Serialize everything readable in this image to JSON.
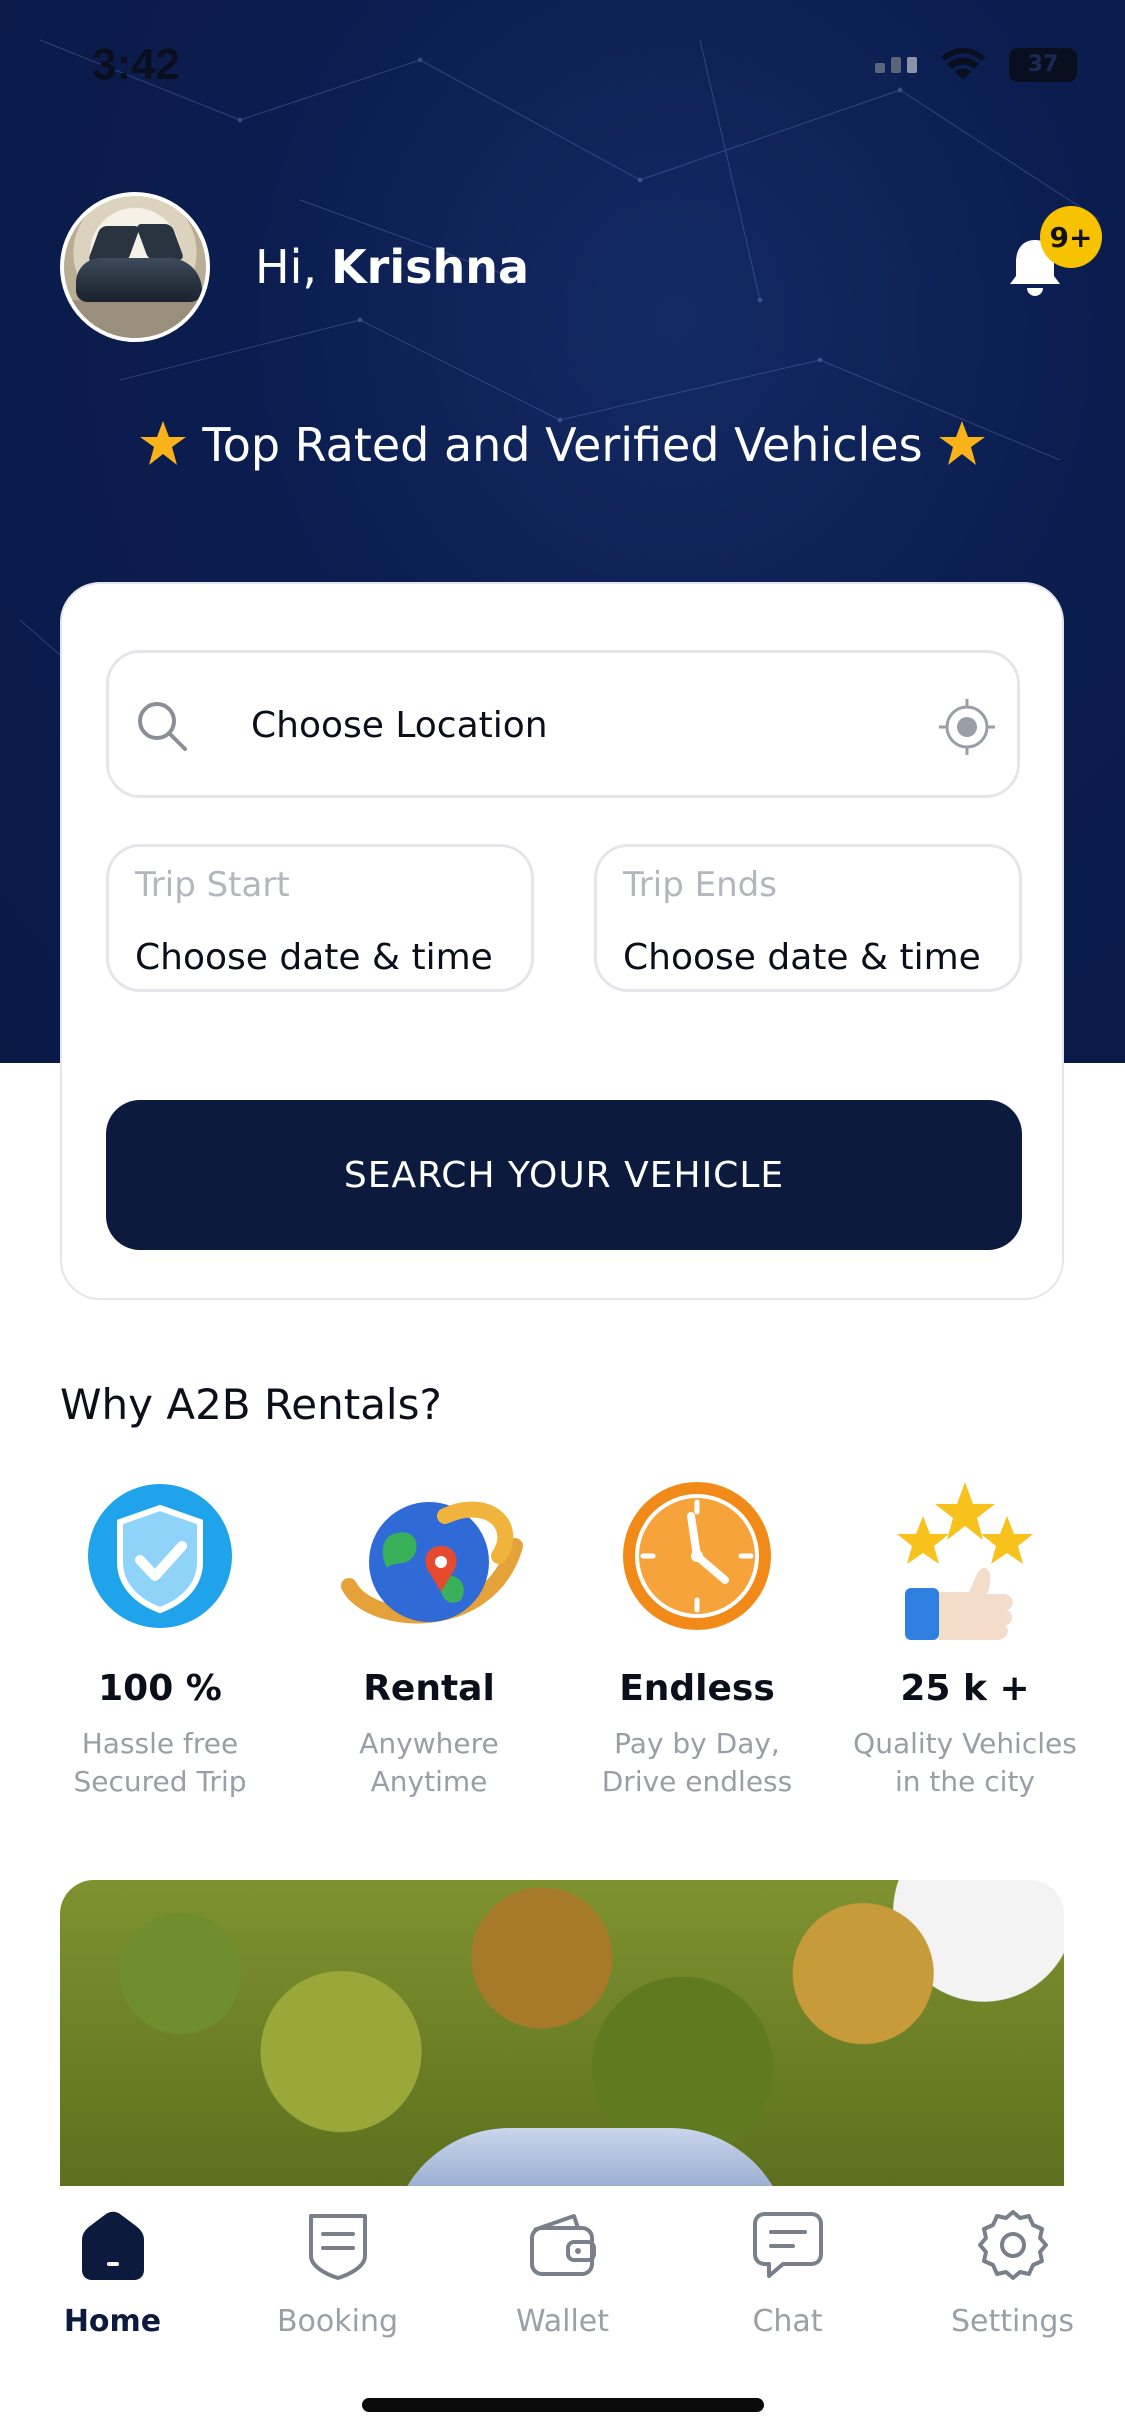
{
  "status_bar": {
    "time": "3:42",
    "battery": "37"
  },
  "header": {
    "greeting_prefix": "Hi,",
    "user_name": "Krishna",
    "notification_count": "9+",
    "tagline": "Top Rated and Verified Vehicles"
  },
  "search": {
    "location_label": "Choose Location",
    "trip_start": {
      "caption": "Trip Start",
      "value": "Choose date & time"
    },
    "trip_end": {
      "caption": "Trip Ends",
      "value": "Choose date & time"
    },
    "button_label": "SEARCH YOUR VEHICLE"
  },
  "why": {
    "title": "Why A2B Rentals?",
    "features": [
      {
        "icon": "shield-check-icon",
        "title": "100 %",
        "line1": "Hassle free",
        "line2": "Secured Trip"
      },
      {
        "icon": "globe-location-icon",
        "title": "Rental",
        "line1": "Anywhere",
        "line2": "Anytime"
      },
      {
        "icon": "clock-icon",
        "title": "Endless",
        "line1": "Pay by Day,",
        "line2": "Drive endless"
      },
      {
        "icon": "thumbs-up-stars-icon",
        "title": "25 k +",
        "line1": "Quality Vehicles",
        "line2": "in the city"
      }
    ]
  },
  "nav": {
    "items": [
      {
        "icon": "home-icon",
        "label": "Home",
        "active": true
      },
      {
        "icon": "booking-icon",
        "label": "Booking"
      },
      {
        "icon": "wallet-icon",
        "label": "Wallet"
      },
      {
        "icon": "chat-icon",
        "label": "Chat"
      },
      {
        "icon": "settings-icon",
        "label": "Settings"
      }
    ]
  },
  "colors": {
    "hero_bg": "#0b1d4f",
    "button_bg": "#0b1a3d",
    "badge": "#f7c300",
    "muted_text": "#9a9ea6"
  }
}
